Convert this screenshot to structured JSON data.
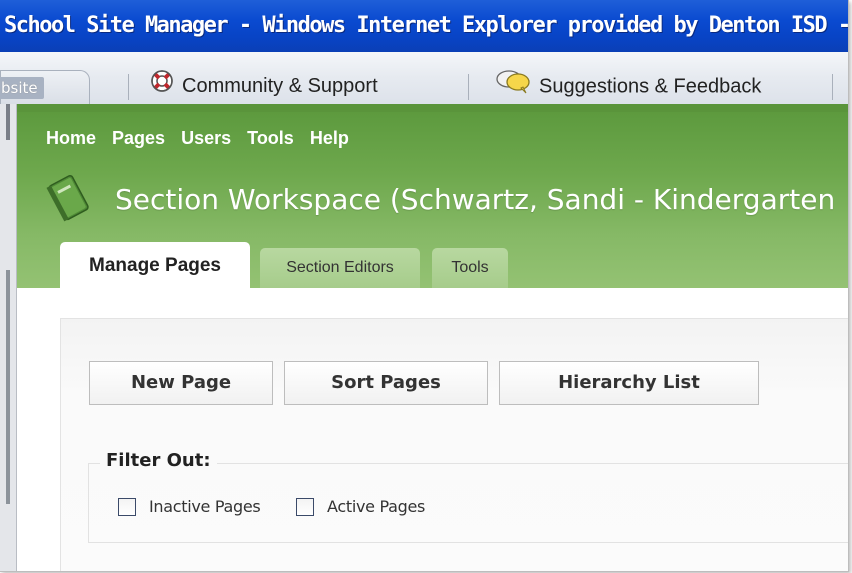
{
  "window": {
    "title": "School Site Manager - Windows Internet Explorer provided by Denton ISD - "
  },
  "command_bar": {
    "website_tab": "bsite",
    "community": "Community & Support",
    "suggestions": "Suggestions & Feedback"
  },
  "top_nav": {
    "items": [
      "Home",
      "Pages",
      "Users",
      "Tools",
      "Help"
    ]
  },
  "workspace": {
    "title": "Section Workspace (Schwartz, Sandi - Kindergarten"
  },
  "tabs": [
    {
      "label": "Manage Pages",
      "active": true
    },
    {
      "label": "Section Editors",
      "active": false
    },
    {
      "label": "Tools",
      "active": false
    }
  ],
  "buttons": {
    "new_page": "New Page",
    "sort_pages": "Sort Pages",
    "hierarchy_list": "Hierarchy List"
  },
  "filter": {
    "legend": "Filter Out:",
    "inactive_label": "Inactive Pages",
    "active_label": "Active Pages",
    "inactive_checked": false,
    "active_checked": false
  },
  "colors": {
    "titlebar": "#0a4ad0",
    "header_green": "#6ea84d",
    "tab_inactive": "#b8d8a0"
  }
}
